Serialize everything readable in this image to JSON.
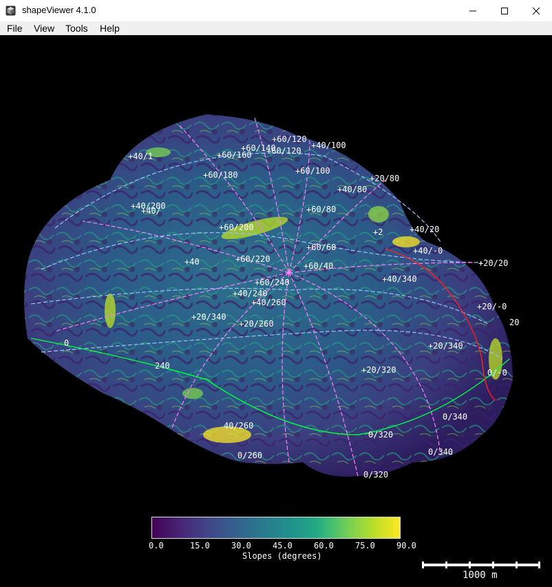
{
  "window": {
    "title": "shapeViewer 4.1.0",
    "icon": "cube-icon",
    "controls": {
      "minimize": "minimize-icon",
      "maximize": "maximize-icon",
      "close": "close-icon"
    }
  },
  "menu": {
    "items": [
      "File",
      "View",
      "Tools",
      "Help"
    ]
  },
  "viewport": {
    "grid_labels": [
      "+60/120",
      "+40/100",
      "+60/140",
      "+60/120",
      "+60/160",
      "+40/1",
      "+60/100",
      "+20/80",
      "+60/180",
      "+40/80",
      "+40/200",
      "+40/",
      "+60/80",
      "+60/200",
      "+40/20",
      "+2",
      "+60/60",
      "+40/-0",
      "+60/220",
      "+20/20",
      "+40",
      "+60/40",
      "+60/240",
      "+40/340",
      "+40/240",
      "+40/260",
      "+20/-0",
      "+20/340",
      "+20/260",
      "20",
      "+20/340",
      "+20/320",
      "0/-0",
      "0/340",
      "240",
      "40/260",
      "0/320",
      "0/340",
      "0/260",
      "0/320",
      "0"
    ],
    "colors": {
      "lat_lines": "#9fc0ff",
      "lon_lines": "#ff80ff",
      "equator": "#00ff40",
      "prime_meridian": "#ff2020"
    }
  },
  "colorbar": {
    "ticks": [
      "0.0",
      "15.0",
      "30.0",
      "45.0",
      "60.0",
      "75.0",
      "90.0"
    ],
    "title": "Slopes (degrees)",
    "colormap": [
      "#440154",
      "#482475",
      "#414487",
      "#355f8d",
      "#2a788e",
      "#21908d",
      "#22a884",
      "#42be71",
      "#7ad151",
      "#bddf26",
      "#fde725"
    ]
  },
  "scalebar": {
    "label": "1000 m"
  }
}
